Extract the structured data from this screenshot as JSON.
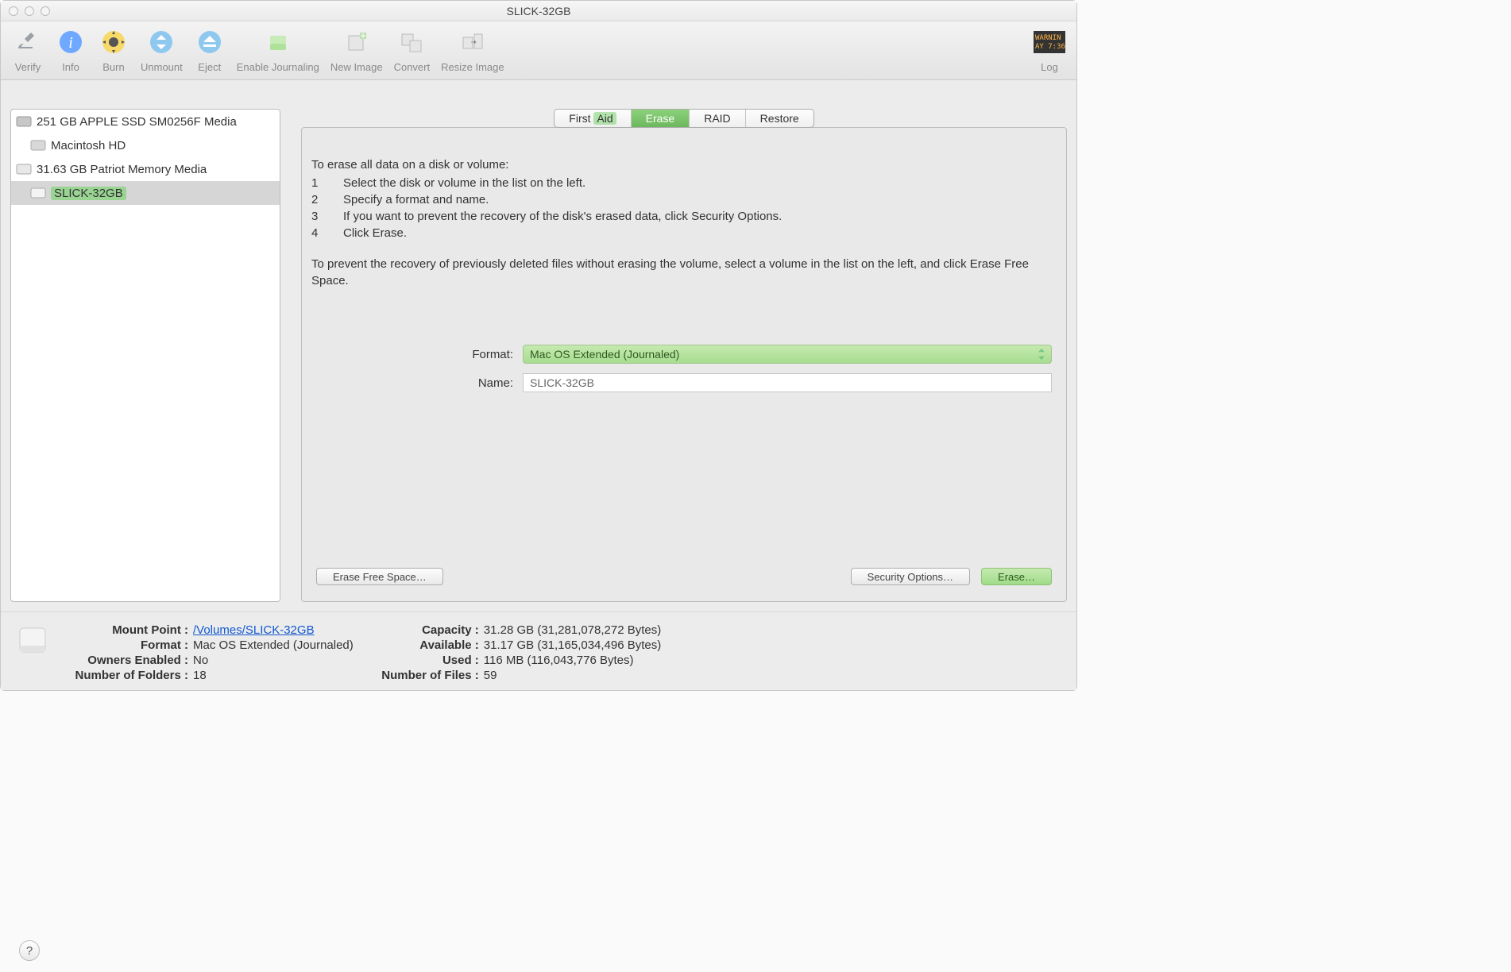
{
  "window": {
    "title": "SLICK-32GB"
  },
  "toolbar": {
    "items": [
      {
        "label": "Verify"
      },
      {
        "label": "Info"
      },
      {
        "label": "Burn"
      },
      {
        "label": "Unmount"
      },
      {
        "label": "Eject"
      },
      {
        "label": "Enable Journaling"
      },
      {
        "label": "New Image"
      },
      {
        "label": "Convert"
      },
      {
        "label": "Resize Image"
      }
    ],
    "log_label": "Log"
  },
  "sidebar": {
    "items": [
      {
        "label": "251 GB APPLE SSD SM0256F Media"
      },
      {
        "label": "Macintosh HD"
      },
      {
        "label": "31.63 GB Patriot Memory Media"
      },
      {
        "label": "SLICK-32GB"
      }
    ]
  },
  "tabs": {
    "first_aid": "First Aid",
    "erase": "Erase",
    "raid": "RAID",
    "restore": "Restore"
  },
  "instructions": {
    "intro": "To erase all data on a disk or volume:",
    "steps": [
      "Select the disk or volume in the list on the left.",
      "Specify a format and name.",
      "If you want to prevent the recovery of the disk's erased data, click Security Options.",
      "Click Erase."
    ],
    "note": "To prevent the recovery of previously deleted files without erasing the volume, select a volume in the list on the left, and click Erase Free Space."
  },
  "form": {
    "format_label": "Format:",
    "format_value": "Mac OS Extended (Journaled)",
    "name_label": "Name:",
    "name_value": "SLICK-32GB"
  },
  "buttons": {
    "erase_free": "Erase Free Space…",
    "security": "Security Options…",
    "erase": "Erase…"
  },
  "footer": {
    "mount_point_label": "Mount Point :",
    "mount_point_value": "/Volumes/SLICK-32GB",
    "format_label": "Format :",
    "format_value": "Mac OS Extended (Journaled)",
    "owners_label": "Owners Enabled :",
    "owners_value": "No",
    "folders_label": "Number of Folders :",
    "folders_value": "18",
    "capacity_label": "Capacity :",
    "capacity_value": "31.28 GB (31,281,078,272 Bytes)",
    "available_label": "Available :",
    "available_value": "31.17 GB (31,165,034,496 Bytes)",
    "used_label": "Used :",
    "used_value": "116 MB (116,043,776 Bytes)",
    "files_label": "Number of Files :",
    "files_value": "59"
  },
  "help": "?"
}
